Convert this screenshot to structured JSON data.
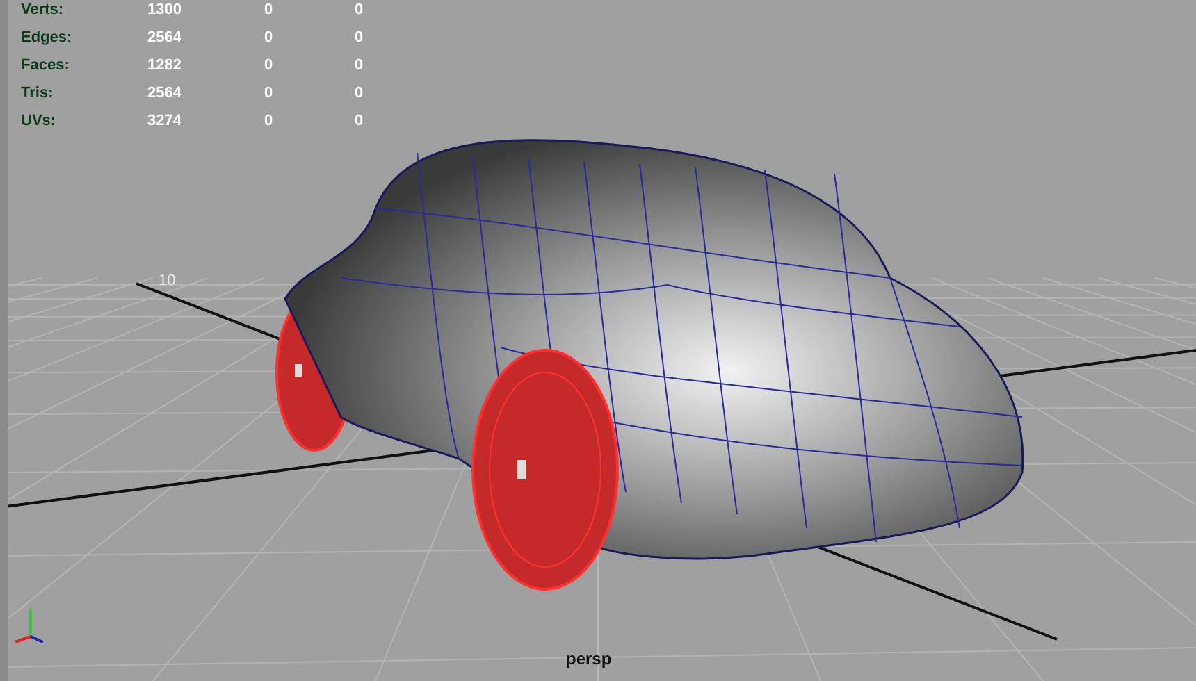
{
  "viewport": {
    "camera_label": "persp",
    "grid_label": "10",
    "stats": [
      {
        "label": "Verts:",
        "values": [
          "1300",
          "0",
          "0"
        ]
      },
      {
        "label": "Edges:",
        "values": [
          "2564",
          "0",
          "0"
        ]
      },
      {
        "label": "Faces:",
        "values": [
          "1282",
          "0",
          "0"
        ]
      },
      {
        "label": "Tris:",
        "values": [
          "2564",
          "0",
          "0"
        ]
      },
      {
        "label": "UVs:",
        "values": [
          "3274",
          "0",
          "0"
        ]
      }
    ]
  },
  "car": {
    "wheels_selected": true
  }
}
